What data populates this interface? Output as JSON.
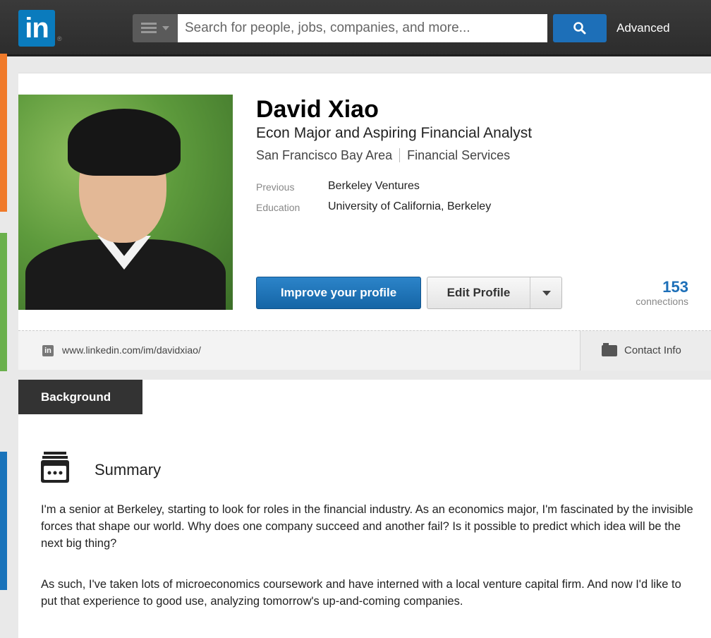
{
  "topbar": {
    "logo_text": "in",
    "logo_reg": "®",
    "search_placeholder": "Search for people, jobs, companies, and more...",
    "advanced_label": "Advanced"
  },
  "profile": {
    "name": "David Xiao",
    "headline": "Econ Major and Aspiring Financial Analyst",
    "location": "San Francisco Bay Area",
    "industry": "Financial Services",
    "previous_label": "Previous",
    "previous_value": "Berkeley Ventures",
    "education_label": "Education",
    "education_value": "University of California, Berkeley",
    "improve_button": "Improve your profile",
    "edit_button": "Edit Profile",
    "connections_count": "153",
    "connections_label": "connections",
    "public_url": "www.linkedin.com/im/davidxiao/",
    "contact_info_label": "Contact Info"
  },
  "background": {
    "tab_label": "Background",
    "summary_title": "Summary",
    "summary_paragraphs": [
      "I'm a senior at Berkeley, starting to look for roles in the financial industry. As an economics major, I'm fascinated by the invisible forces that shape our world. Why does one company succeed and another fail? Is it possible to predict which idea will be the next big thing?",
      "As such, I've taken lots of microeconomics coursework and have interned with a local venture capital firm. And now I'd like to put that experience to good use, analyzing tomorrow's up-and-coming companies."
    ]
  },
  "colors": {
    "brand_blue": "#0a7bbd",
    "button_blue": "#1d6fb8",
    "strip_orange": "#f07a2a",
    "strip_green": "#6ab04c",
    "strip_blue": "#1a73ba"
  }
}
